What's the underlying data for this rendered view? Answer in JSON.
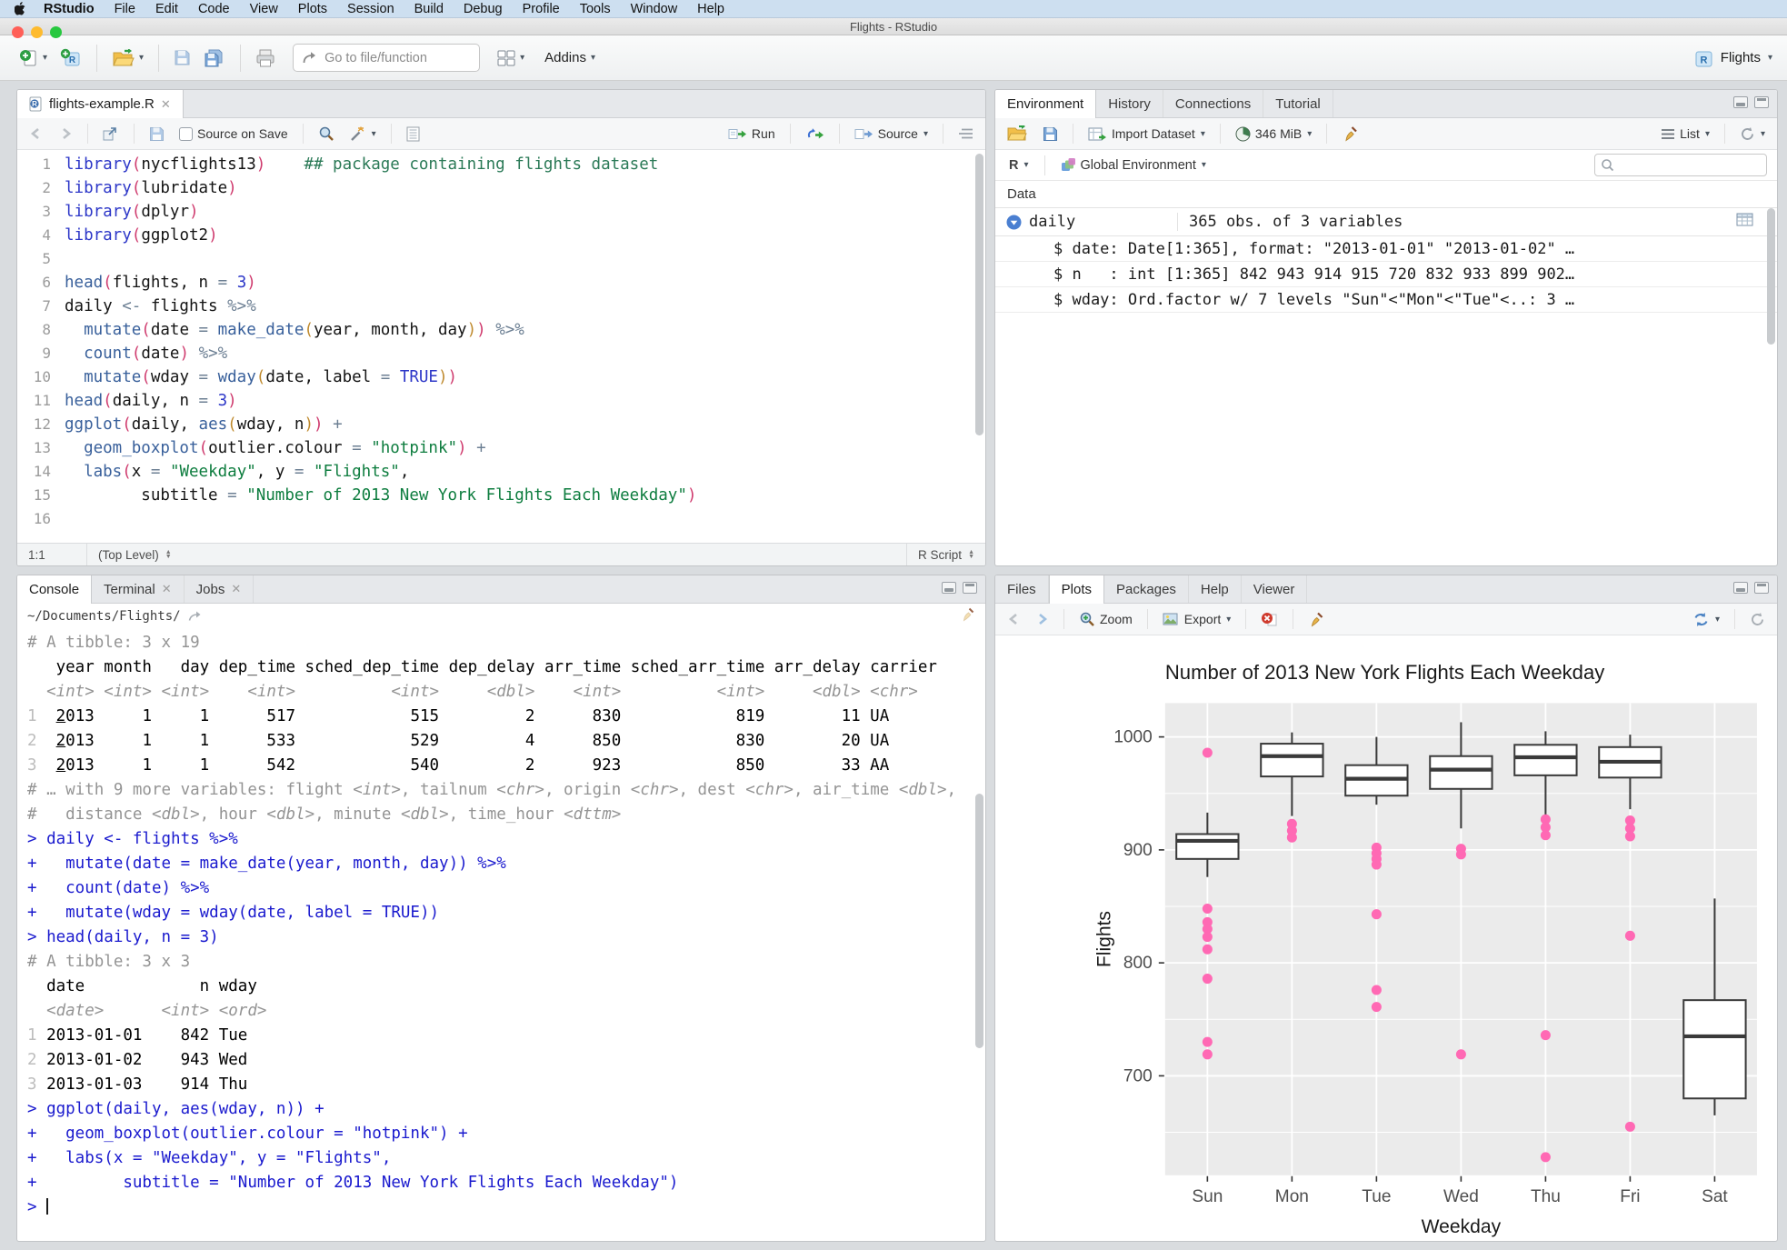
{
  "colors": {
    "accent_blue": "#4d84c4",
    "hotpink": "#FF69B4",
    "menu_bg": "#cddff0"
  },
  "menubar": {
    "items": [
      "RStudio",
      "File",
      "Edit",
      "Code",
      "View",
      "Plots",
      "Session",
      "Build",
      "Debug",
      "Profile",
      "Tools",
      "Window",
      "Help"
    ]
  },
  "titlebar": {
    "title": "Flights - RStudio"
  },
  "toolbar": {
    "goto_placeholder": "Go to file/function",
    "addins_label": "Addins",
    "project_name": "Flights"
  },
  "source_pane": {
    "tab_label": "flights-example.R",
    "toolbar": {
      "source_on_save": "Source on Save",
      "run_label": "Run",
      "source_label": "Source"
    },
    "status": {
      "position": "1:1",
      "scope": "(Top Level)",
      "file_type": "R Script"
    },
    "lines": [
      {
        "n": "1",
        "segs": [
          [
            "kw",
            "library"
          ],
          [
            "p1",
            "("
          ],
          [
            "id",
            "nycflights13"
          ],
          [
            "p1",
            ")"
          ],
          [
            "pl",
            "    "
          ],
          [
            "com",
            "## package containing flights dataset"
          ]
        ]
      },
      {
        "n": "2",
        "segs": [
          [
            "kw",
            "library"
          ],
          [
            "p1",
            "("
          ],
          [
            "id",
            "lubridate"
          ],
          [
            "p1",
            ")"
          ]
        ]
      },
      {
        "n": "3",
        "segs": [
          [
            "kw",
            "library"
          ],
          [
            "p1",
            "("
          ],
          [
            "id",
            "dplyr"
          ],
          [
            "p1",
            ")"
          ]
        ]
      },
      {
        "n": "4",
        "segs": [
          [
            "kw",
            "library"
          ],
          [
            "p1",
            "("
          ],
          [
            "id",
            "ggplot2"
          ],
          [
            "p1",
            ")"
          ]
        ]
      },
      {
        "n": "5",
        "segs": []
      },
      {
        "n": "6",
        "segs": [
          [
            "fn",
            "head"
          ],
          [
            "p1",
            "("
          ],
          [
            "id",
            "flights, n "
          ],
          [
            "op",
            "= "
          ],
          [
            "num",
            "3"
          ],
          [
            "p1",
            ")"
          ]
        ]
      },
      {
        "n": "7",
        "segs": [
          [
            "id",
            "daily "
          ],
          [
            "op",
            "<- "
          ],
          [
            "id",
            "flights "
          ],
          [
            "op",
            "%>%"
          ]
        ]
      },
      {
        "n": "8",
        "segs": [
          [
            "id",
            "  "
          ],
          [
            "fn",
            "mutate"
          ],
          [
            "p1",
            "("
          ],
          [
            "id",
            "date "
          ],
          [
            "op",
            "= "
          ],
          [
            "fn",
            "make_date"
          ],
          [
            "p2",
            "("
          ],
          [
            "id",
            "year, month, day"
          ],
          [
            "p2",
            ")"
          ],
          [
            "p1",
            ")"
          ],
          [
            "id",
            " "
          ],
          [
            "op",
            "%>%"
          ]
        ]
      },
      {
        "n": "9",
        "segs": [
          [
            "id",
            "  "
          ],
          [
            "fn",
            "count"
          ],
          [
            "p1",
            "("
          ],
          [
            "id",
            "date"
          ],
          [
            "p1",
            ")"
          ],
          [
            "id",
            " "
          ],
          [
            "op",
            "%>%"
          ]
        ]
      },
      {
        "n": "10",
        "segs": [
          [
            "id",
            "  "
          ],
          [
            "fn",
            "mutate"
          ],
          [
            "p1",
            "("
          ],
          [
            "id",
            "wday "
          ],
          [
            "op",
            "= "
          ],
          [
            "fn",
            "wday"
          ],
          [
            "p2",
            "("
          ],
          [
            "id",
            "date, label "
          ],
          [
            "op",
            "= "
          ],
          [
            "kw",
            "TRUE"
          ],
          [
            "p2",
            ")"
          ],
          [
            "p1",
            ")"
          ]
        ]
      },
      {
        "n": "11",
        "segs": [
          [
            "fn",
            "head"
          ],
          [
            "p1",
            "("
          ],
          [
            "id",
            "daily, n "
          ],
          [
            "op",
            "= "
          ],
          [
            "num",
            "3"
          ],
          [
            "p1",
            ")"
          ]
        ]
      },
      {
        "n": "12",
        "segs": [
          [
            "fn",
            "ggplot"
          ],
          [
            "p1",
            "("
          ],
          [
            "id",
            "daily, "
          ],
          [
            "fn",
            "aes"
          ],
          [
            "p2",
            "("
          ],
          [
            "id",
            "wday, n"
          ],
          [
            "p2",
            ")"
          ],
          [
            "p1",
            ")"
          ],
          [
            "id",
            " "
          ],
          [
            "op",
            "+"
          ]
        ]
      },
      {
        "n": "13",
        "segs": [
          [
            "id",
            "  "
          ],
          [
            "fn",
            "geom_boxplot"
          ],
          [
            "p1",
            "("
          ],
          [
            "id",
            "outlier.colour "
          ],
          [
            "op",
            "= "
          ],
          [
            "str",
            "\"hotpink\""
          ],
          [
            "p1",
            ")"
          ],
          [
            "id",
            " "
          ],
          [
            "op",
            "+"
          ]
        ]
      },
      {
        "n": "14",
        "segs": [
          [
            "id",
            "  "
          ],
          [
            "fn",
            "labs"
          ],
          [
            "p1",
            "("
          ],
          [
            "id",
            "x "
          ],
          [
            "op",
            "= "
          ],
          [
            "str",
            "\"Weekday\""
          ],
          [
            "id",
            ", y "
          ],
          [
            "op",
            "= "
          ],
          [
            "str",
            "\"Flights\""
          ],
          [
            "id",
            ","
          ]
        ]
      },
      {
        "n": "15",
        "segs": [
          [
            "id",
            "        "
          ],
          [
            "id",
            "subtitle "
          ],
          [
            "op",
            "= "
          ],
          [
            "str",
            "\"Number of 2013 New York Flights Each Weekday\""
          ],
          [
            "p1",
            ")"
          ]
        ]
      },
      {
        "n": "16",
        "segs": []
      }
    ]
  },
  "environment_pane": {
    "tabs": [
      "Environment",
      "History",
      "Connections",
      "Tutorial"
    ],
    "active_tab": "Environment",
    "toolbar": {
      "import_label": "Import Dataset",
      "memory_label": "346 MiB",
      "list_label": "List"
    },
    "env_row": {
      "language": "R",
      "environment": "Global Environment"
    },
    "data_section_label": "Data",
    "object": {
      "name": "daily",
      "summary": "365 obs. of 3 variables"
    },
    "fields": [
      "$ date: Date[1:365], format: \"2013-01-01\" \"2013-01-02\" …",
      "$ n   : int [1:365] 842 943 914 915 720 832 933 899 902…",
      "$ wday: Ord.factor w/ 7 levels \"Sun\"<\"Mon\"<\"Tue\"<..: 3 …"
    ]
  },
  "console_pane": {
    "tabs": [
      {
        "label": "Console",
        "closable": false
      },
      {
        "label": "Terminal",
        "closable": true
      },
      {
        "label": "Jobs",
        "closable": true
      }
    ],
    "active_tab": "Console",
    "working_directory": "~/Documents/Flights/",
    "lines": [
      [
        [
          "m",
          "# A tibble: 3 x 19"
        ]
      ],
      [
        [
          "o",
          "   year month   day dep_time sched_dep_time dep_delay arr_time sched_arr_time arr_delay carrier"
        ]
      ],
      [
        [
          "mi",
          "  <int> <int> <int>    <int>          <int>     <dbl>    <int>          <int>     <dbl> <chr>"
        ]
      ],
      [
        [
          "i",
          "1"
        ],
        [
          "o",
          "  "
        ],
        [
          "u",
          "2"
        ],
        [
          "o",
          "013     1     1      517            515         2      830            819        11 UA"
        ]
      ],
      [
        [
          "i",
          "2"
        ],
        [
          "o",
          "  "
        ],
        [
          "u",
          "2"
        ],
        [
          "o",
          "013     1     1      533            529         4      850            830        20 UA"
        ]
      ],
      [
        [
          "i",
          "3"
        ],
        [
          "o",
          "  "
        ],
        [
          "u",
          "2"
        ],
        [
          "o",
          "013     1     1      542            540         2      923            850        33 AA"
        ]
      ],
      [
        [
          "m",
          "# … with 9 more variables: flight "
        ],
        [
          "mi",
          "<int>"
        ],
        [
          "m",
          ", tailnum "
        ],
        [
          "mi",
          "<chr>"
        ],
        [
          "m",
          ", origin "
        ],
        [
          "mi",
          "<chr>"
        ],
        [
          "m",
          ", dest "
        ],
        [
          "mi",
          "<chr>"
        ],
        [
          "m",
          ", air_time "
        ],
        [
          "mi",
          "<dbl>"
        ],
        [
          "m",
          ","
        ]
      ],
      [
        [
          "m",
          "#   distance "
        ],
        [
          "mi",
          "<dbl>"
        ],
        [
          "m",
          ", hour "
        ],
        [
          "mi",
          "<dbl>"
        ],
        [
          "m",
          ", minute "
        ],
        [
          "mi",
          "<dbl>"
        ],
        [
          "m",
          ", time_hour "
        ],
        [
          "mi",
          "<dttm>"
        ]
      ],
      [
        [
          "c",
          "> daily <- flights %>%"
        ]
      ],
      [
        [
          "c",
          "+   mutate(date = make_date(year, month, day)) %>%"
        ]
      ],
      [
        [
          "c",
          "+   count(date) %>%"
        ]
      ],
      [
        [
          "c",
          "+   mutate(wday = wday(date, label = TRUE))"
        ]
      ],
      [
        [
          "c",
          "> head(daily, n = 3)"
        ]
      ],
      [
        [
          "m",
          "# A tibble: 3 x 3"
        ]
      ],
      [
        [
          "o",
          "  date            n wday"
        ]
      ],
      [
        [
          "mi",
          "  <date>      <int> <ord>"
        ]
      ],
      [
        [
          "i",
          "1"
        ],
        [
          "o",
          " 2013-01-01    842 Tue"
        ]
      ],
      [
        [
          "i",
          "2"
        ],
        [
          "o",
          " 2013-01-02    943 Wed"
        ]
      ],
      [
        [
          "i",
          "3"
        ],
        [
          "o",
          " 2013-01-03    914 Thu"
        ]
      ],
      [
        [
          "c",
          "> ggplot(daily, aes(wday, n)) +"
        ]
      ],
      [
        [
          "c",
          "+   geom_boxplot(outlier.colour = \"hotpink\") +"
        ]
      ],
      [
        [
          "c",
          "+   labs(x = \"Weekday\", y = \"Flights\","
        ]
      ],
      [
        [
          "c",
          "+         subtitle = \"Number of 2013 New York Flights Each Weekday\")"
        ]
      ],
      [
        [
          "c",
          "> "
        ],
        [
          "cursor",
          ""
        ]
      ]
    ]
  },
  "plots_pane": {
    "tabs": [
      "Files",
      "Plots",
      "Packages",
      "Help",
      "Viewer"
    ],
    "active_tab": "Plots",
    "toolbar": {
      "zoom_label": "Zoom",
      "export_label": "Export"
    }
  },
  "chart_data": {
    "type": "boxplot",
    "title": "Number of 2013 New York Flights Each Weekday",
    "xlabel": "Weekday",
    "ylabel": "Flights",
    "categories": [
      "Sun",
      "Mon",
      "Tue",
      "Wed",
      "Thu",
      "Fri",
      "Sat"
    ],
    "ylim": [
      612,
      1030
    ],
    "yticks": [
      700,
      800,
      900,
      1000
    ],
    "yticks_minor": [
      650,
      750,
      850,
      950
    ],
    "panel_bg": "#EBEBEB",
    "grid_color": "#FFFFFF",
    "box_color": "#3a3a3a",
    "outlier_color": "#FF69B4",
    "legend": "none",
    "series": [
      {
        "category": "Sun",
        "whisker_low": 876,
        "q1": 892,
        "median": 908,
        "q3": 914,
        "whisker_high": 933,
        "outliers": [
          986,
          848,
          836,
          830,
          823,
          812,
          786,
          730,
          719
        ]
      },
      {
        "category": "Mon",
        "whisker_low": 930,
        "q1": 965,
        "median": 983,
        "q3": 994,
        "whisker_high": 1004,
        "outliers": [
          923,
          917,
          911
        ]
      },
      {
        "category": "Tue",
        "whisker_low": 940,
        "q1": 948,
        "median": 963,
        "q3": 975,
        "whisker_high": 1000,
        "outliers": [
          902,
          897,
          892,
          887,
          843,
          776,
          761
        ]
      },
      {
        "category": "Wed",
        "whisker_low": 919,
        "q1": 954,
        "median": 971,
        "q3": 983,
        "whisker_high": 1013,
        "outliers": [
          901,
          896,
          719
        ]
      },
      {
        "category": "Thu",
        "whisker_low": 931,
        "q1": 966,
        "median": 982,
        "q3": 993,
        "whisker_high": 1005,
        "outliers": [
          927,
          920,
          913,
          736,
          628
        ]
      },
      {
        "category": "Fri",
        "whisker_low": 936,
        "q1": 964,
        "median": 978,
        "q3": 991,
        "whisker_high": 1002,
        "outliers": [
          926,
          919,
          912,
          824,
          655
        ]
      },
      {
        "category": "Sat",
        "whisker_low": 665,
        "q1": 680,
        "median": 735,
        "q3": 767,
        "whisker_high": 857,
        "outliers": []
      }
    ]
  }
}
